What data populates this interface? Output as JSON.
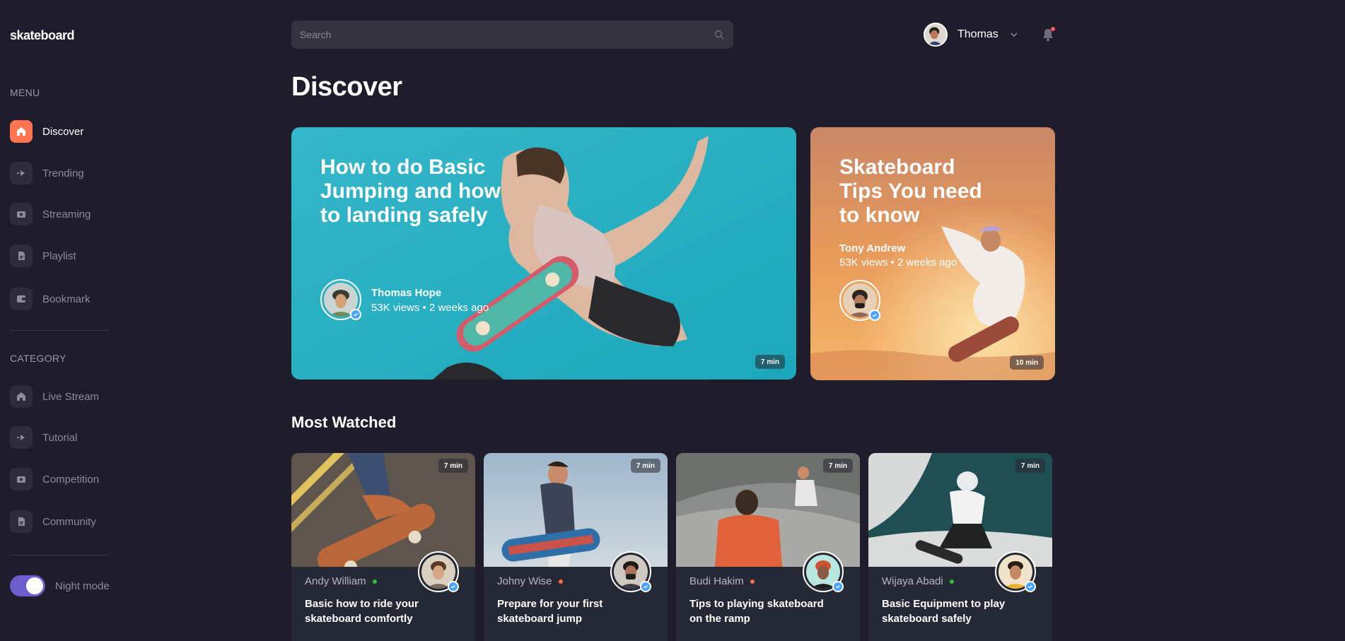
{
  "app": {
    "logo": "skateboard"
  },
  "sidebar": {
    "menu_title": "MENU",
    "menu_items": [
      {
        "label": "Discover",
        "icon": "home-icon",
        "active": true
      },
      {
        "label": "Trending",
        "icon": "arrow-right-icon"
      },
      {
        "label": "Streaming",
        "icon": "video-icon"
      },
      {
        "label": "Playlist",
        "icon": "document-icon"
      },
      {
        "label": "Bookmark",
        "icon": "bookmark-icon"
      }
    ],
    "category_title": "CATEGORY",
    "category_items": [
      {
        "label": "Live Stream",
        "icon": "home-icon"
      },
      {
        "label": "Tutorial",
        "icon": "arrow-right-icon"
      },
      {
        "label": "Competition",
        "icon": "video-icon"
      },
      {
        "label": "Community",
        "icon": "document-icon"
      }
    ],
    "night_mode": {
      "label": "Night mode",
      "enabled": true
    }
  },
  "header": {
    "search_placeholder": "Search",
    "user_name": "Thomas"
  },
  "page_title": "Discover",
  "featured": [
    {
      "title": "How to do Basic Jumping and how to landing safely",
      "author": "Thomas Hope",
      "meta": "53K views • 2 weeks ago",
      "duration": "7 min"
    },
    {
      "title": "Skateboard Tips You need to know",
      "author": "Tony Andrew",
      "meta": "53K views • 2 weeks ago",
      "duration": "10 min"
    }
  ],
  "most_watched_title": "Most Watched",
  "videos": [
    {
      "author": "Andy William",
      "status": "online",
      "title": "Basic how to ride your skateboard comfortly",
      "duration": "7 min"
    },
    {
      "author": "Johny Wise",
      "status": "busy",
      "title": "Prepare for your first skateboard jump",
      "duration": "7 min"
    },
    {
      "author": "Budi Hakim",
      "status": "busy",
      "title": "Tips to playing skateboard on the ramp",
      "duration": "7 min"
    },
    {
      "author": "Wijaya Abadi",
      "status": "online",
      "title": "Basic Equipment to play skateboard safely",
      "duration": "7 min"
    }
  ],
  "colors": {
    "background": "#1f1d2b",
    "accent": "#ff7551",
    "toggle": "#6c5ecf",
    "online": "#2fbf3a",
    "busy": "#ff6a4d",
    "verified": "#4aa3ff"
  }
}
